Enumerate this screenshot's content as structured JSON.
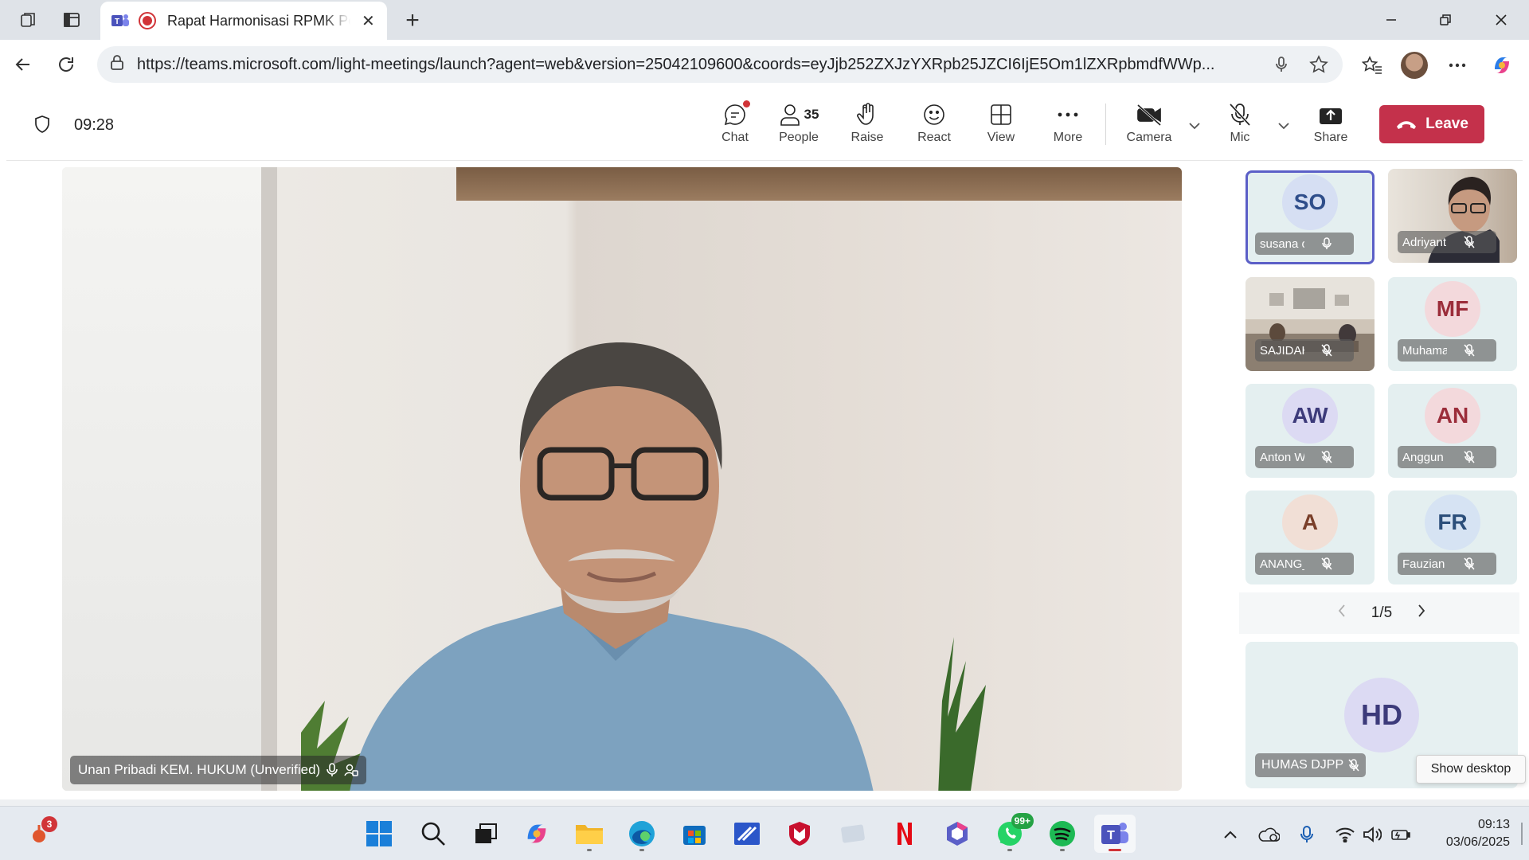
{
  "browser": {
    "tab_title": "Rapat Harmonisasi RPMK Pe",
    "new_tab": "+",
    "url": "https://teams.microsoft.com/light-meetings/launch?agent=web&version=25042109600&coords=eyJjb252ZXJzYXRpb25JZCI6IjE5Om1lZXRpbmdfWWp..."
  },
  "meeting": {
    "timer": "09:28",
    "controls": {
      "chat": "Chat",
      "people": "People",
      "people_count": "35",
      "raise": "Raise",
      "react": "React",
      "view": "View",
      "more": "More",
      "camera": "Camera",
      "mic": "Mic",
      "share": "Share",
      "leave": "Leave"
    },
    "main_speaker": "Unan Pribadi KEM. HUKUM (Unverified)",
    "participants": [
      {
        "initials": "SO",
        "name": "susana o...",
        "mic": "on"
      },
      {
        "initials": "",
        "name": "Adriyant...",
        "mic": "muted"
      },
      {
        "initials": "",
        "name": "SAJIDAH...",
        "mic": "muted"
      },
      {
        "initials": "MF",
        "name": "Muhama...",
        "mic": "muted"
      },
      {
        "initials": "AW",
        "name": "Anton W...",
        "mic": "muted"
      },
      {
        "initials": "AN",
        "name": "Anggun ...",
        "mic": "muted"
      },
      {
        "initials": "A",
        "name": "ANANG_...",
        "mic": "muted"
      },
      {
        "initials": "FR",
        "name": "Fauzian ...",
        "mic": "muted"
      }
    ],
    "pager": "1/5",
    "featured": {
      "initials": "HD",
      "name": "HUMAS DJPP"
    },
    "tooltip": "Show desktop"
  },
  "taskbar": {
    "notification_count": "3",
    "whatsapp_badge": "99+",
    "time": "09:13",
    "date": "03/06/2025"
  },
  "colors": {
    "accent": "#5b5fc7",
    "leave": "#c4314b",
    "recording": "#d13438"
  }
}
